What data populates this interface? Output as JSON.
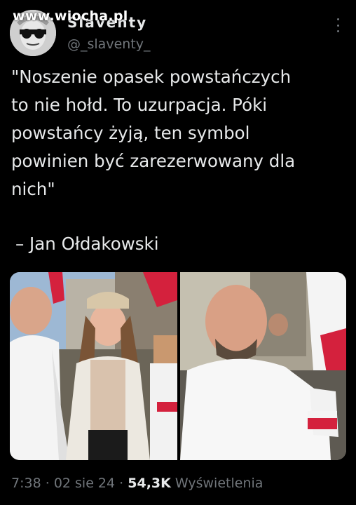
{
  "watermark": "www.wiocha.pl",
  "author": {
    "display_name": "Slaventy",
    "handle": "@_slaventy_"
  },
  "tweet": {
    "lines": [
      "\"Noszenie opasek powstańczych",
      "to nie hołd. To uzurpacja. Póki",
      "powstańcy żyją, ten symbol",
      "powinien być zarezerwowany dla",
      "nich\""
    ],
    "attribution": "– Jan Ołdakowski"
  },
  "meta": {
    "time": "7:38",
    "separator": "·",
    "date": "02 sie 24",
    "views_count": "54,3K",
    "views_label": "Wyświetlenia"
  },
  "colors": {
    "background": "#000000",
    "text": "#e7e9ea",
    "secondary": "#71767b",
    "flag_red": "#d4213d",
    "flag_white": "#f4f4f4"
  },
  "icons": [
    "more-icon"
  ]
}
